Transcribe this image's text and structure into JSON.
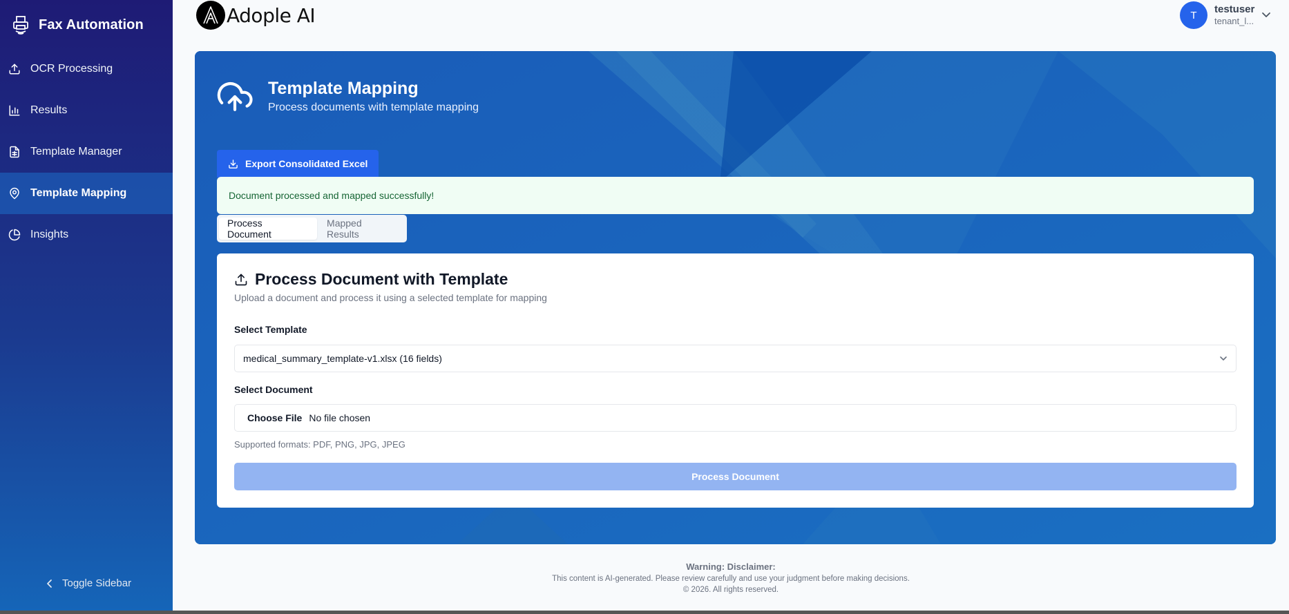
{
  "sidebar": {
    "title": "Fax Automation",
    "items": [
      {
        "label": "OCR Processing",
        "icon": "upload-icon"
      },
      {
        "label": "Results",
        "icon": "bar-chart-icon"
      },
      {
        "label": "Template Manager",
        "icon": "spreadsheet-icon"
      },
      {
        "label": "Template Mapping",
        "icon": "map-pin-icon",
        "active": true
      },
      {
        "label": "Insights",
        "icon": "pie-chart-icon"
      }
    ],
    "toggle_label": "Toggle Sidebar"
  },
  "header": {
    "logo_text": "Adople AI",
    "user": {
      "initial": "T",
      "name": "testuser",
      "tenant": "tenant_l..."
    }
  },
  "hero": {
    "title": "Template Mapping",
    "subtitle": "Process documents with template mapping"
  },
  "toolbar": {
    "export_label": "Export Consolidated Excel"
  },
  "alert": {
    "message": "Document processed and mapped successfully!"
  },
  "tabs": [
    {
      "label": "Process Document",
      "active": true
    },
    {
      "label": "Mapped Results",
      "active": false
    }
  ],
  "card": {
    "title": "Process Document with Template",
    "description": "Upload a document and process it using a selected template for mapping",
    "template_label": "Select Template",
    "template_value": "medical_summary_template-v1.xlsx (16 fields)",
    "document_label": "Select Document",
    "file_button": "Choose File",
    "file_status": "No file chosen",
    "formats": "Supported formats: PDF, PNG, JPG, JPEG",
    "process_label": "Process Document"
  },
  "footer": {
    "warning": "Warning: Disclaimer:",
    "note": "This content is AI-generated. Please review carefully and use your judgment before making decisions.",
    "copyright": "© 2026. All rights reserved."
  },
  "colors": {
    "sidebar_top": "#1e1b75",
    "sidebar_bottom": "#1565b8",
    "accent": "#2563eb",
    "hero": "#1565c0",
    "success_bg": "#f0fdf4",
    "success_text": "#166534",
    "disabled_button": "#93b4f2"
  }
}
